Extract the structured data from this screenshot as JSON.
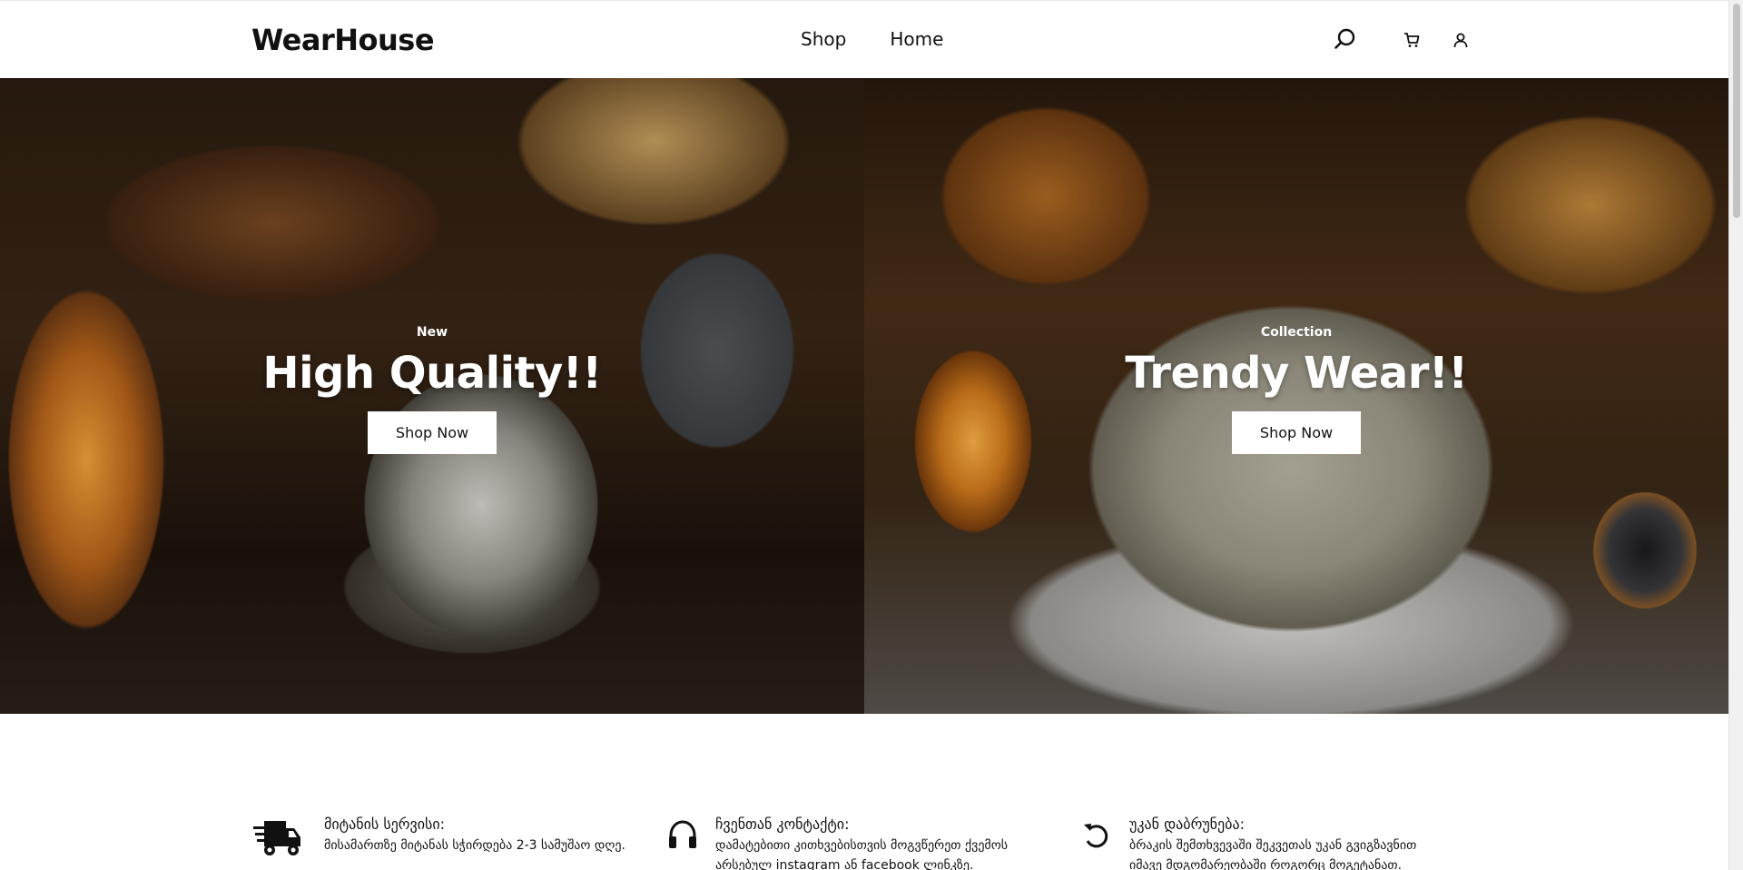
{
  "header": {
    "logo": "WearHouse",
    "nav": [
      {
        "label": "Shop"
      },
      {
        "label": "Home"
      }
    ],
    "icons": [
      "search-icon",
      "cart-icon",
      "user-icon"
    ]
  },
  "hero": {
    "left": {
      "eyebrow": "New",
      "title": "High Quality!!",
      "button": "Shop Now"
    },
    "right": {
      "eyebrow": "Collection",
      "title": "Trendy Wear!!",
      "button": "Shop Now"
    }
  },
  "features": [
    {
      "icon": "delivery-truck-icon",
      "title": "მიტანის სერვისი:",
      "desc": "მისამართზე მიტანას სჭირდება 2-3 სამუშაო დღე."
    },
    {
      "icon": "headset-icon",
      "title": "ჩვენთან კონტაქტი:",
      "desc": "დამატებითი კითხვებისთვის მოგვწერეთ ქვემოს არსებულ instagram ან facebook ლინკზე."
    },
    {
      "icon": "return-arrow-icon",
      "title": "უკან დაბრუნება:",
      "desc": "ბრაკის შემთხვევაში შეკვეთას უკან გვიგზავნით იმავე მდგომარეობაში როგორც მოგეტანათ."
    }
  ],
  "colors": {
    "text": "#111111",
    "background": "#ffffff",
    "button_bg": "#ffffff"
  }
}
